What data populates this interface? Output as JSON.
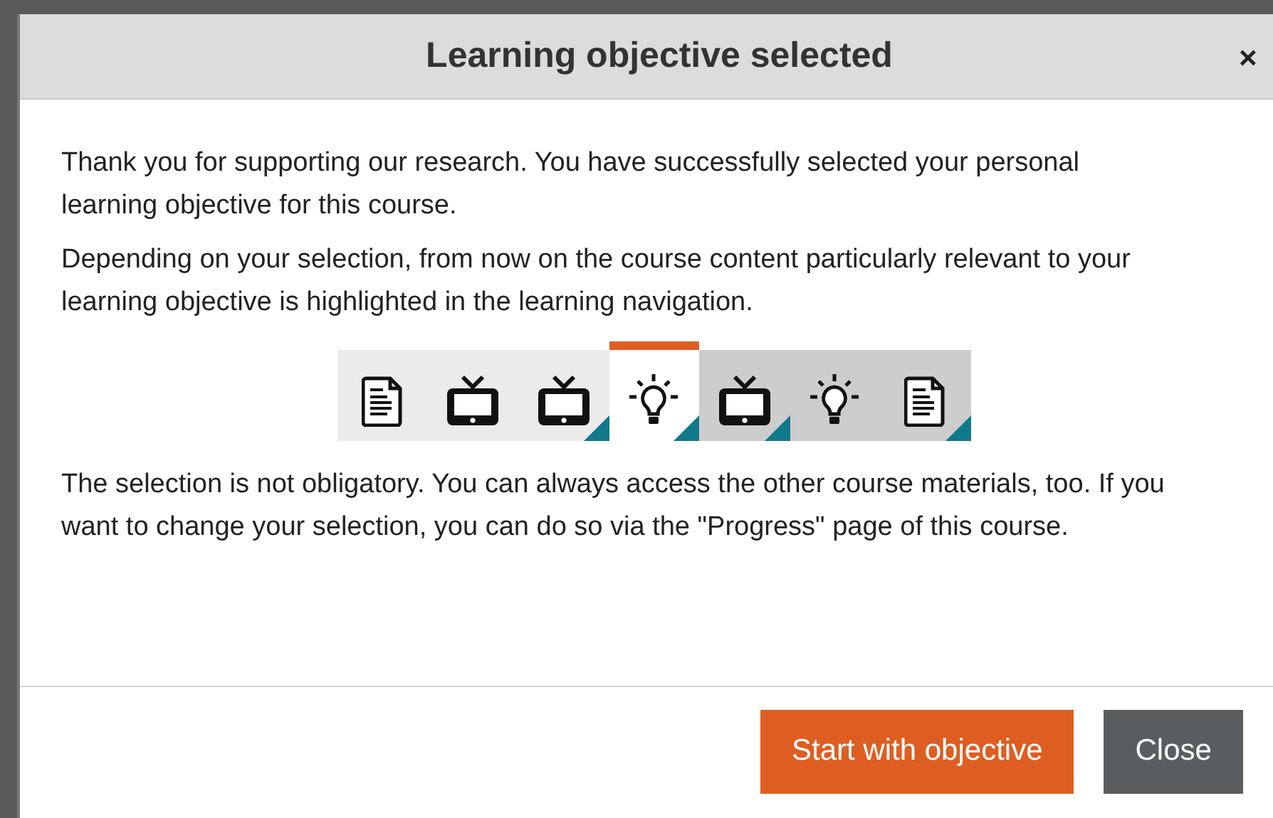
{
  "dialog": {
    "title": "Learning objective selected",
    "close_icon": "×"
  },
  "paragraphs": [
    "Thank you for supporting our research. You have successfully selected your personal learning objective for this course.",
    "Depending on your selection, from now on the course content particularly relevant to your learning objective is highlighted in the learning navigation.",
    "The selection is not obligatory. You can always access the other course materials, too. If you want to change your selection, you can do so via the \"Progress\" page of this course."
  ],
  "navigation": [
    {
      "kind": "document",
      "selected": false,
      "visited": false,
      "highlighted": false
    },
    {
      "kind": "video",
      "selected": false,
      "visited": false,
      "highlighted": false
    },
    {
      "kind": "video",
      "selected": false,
      "visited": false,
      "highlighted": true
    },
    {
      "kind": "idea",
      "selected": true,
      "highlighted": true
    },
    {
      "kind": "video",
      "selected": false,
      "visited": true,
      "highlighted": true
    },
    {
      "kind": "idea",
      "selected": false,
      "visited": true,
      "highlighted": false
    },
    {
      "kind": "document",
      "selected": false,
      "visited": true,
      "highlighted": true
    }
  ],
  "buttons": [
    {
      "label": "Start with objective",
      "kind": "primary"
    },
    {
      "label": "Close",
      "kind": "secondary"
    }
  ]
}
